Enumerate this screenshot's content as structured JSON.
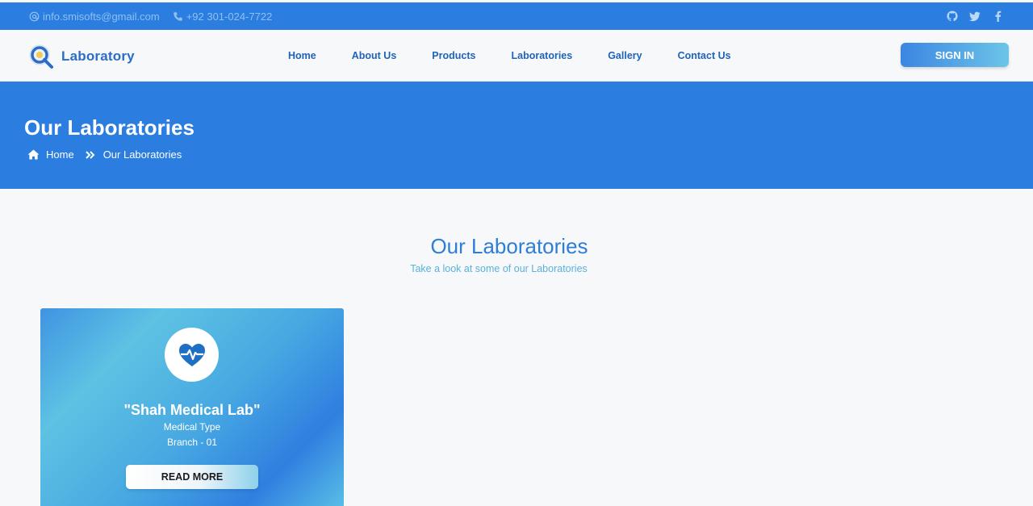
{
  "topbar": {
    "email": "info.smisofts@gmail.com",
    "phone": "+92 301-024-7722",
    "email_icon": "at-icon",
    "phone_icon": "phone-icon",
    "social": [
      "github-icon",
      "twitter-icon",
      "facebook-icon"
    ]
  },
  "navbar": {
    "brand_name": "Laboratory",
    "brand_icon": "magnifier-logo-icon",
    "links": [
      "Home",
      "About Us",
      "Products",
      "Laboratories",
      "Gallery",
      "Contact Us"
    ],
    "signin_label": "SIGN IN"
  },
  "hero": {
    "title": "Our Laboratories",
    "breadcrumb": [
      "Home",
      "Our Laboratories"
    ]
  },
  "section": {
    "title": "Our Laboratories",
    "subtitle": "Take a look at some of our Laboratories"
  },
  "cards": [
    {
      "name": "\"Shah Medical Lab\"",
      "type": "Medical Type",
      "branch": "Branch - 01",
      "button": "READ MORE",
      "icon": "heartbeat-icon"
    }
  ],
  "colors": {
    "primary": "#2b7de0",
    "nav_text": "#1f63b8",
    "section_title": "#2e7dd6",
    "section_subtitle": "#59b1dc"
  }
}
